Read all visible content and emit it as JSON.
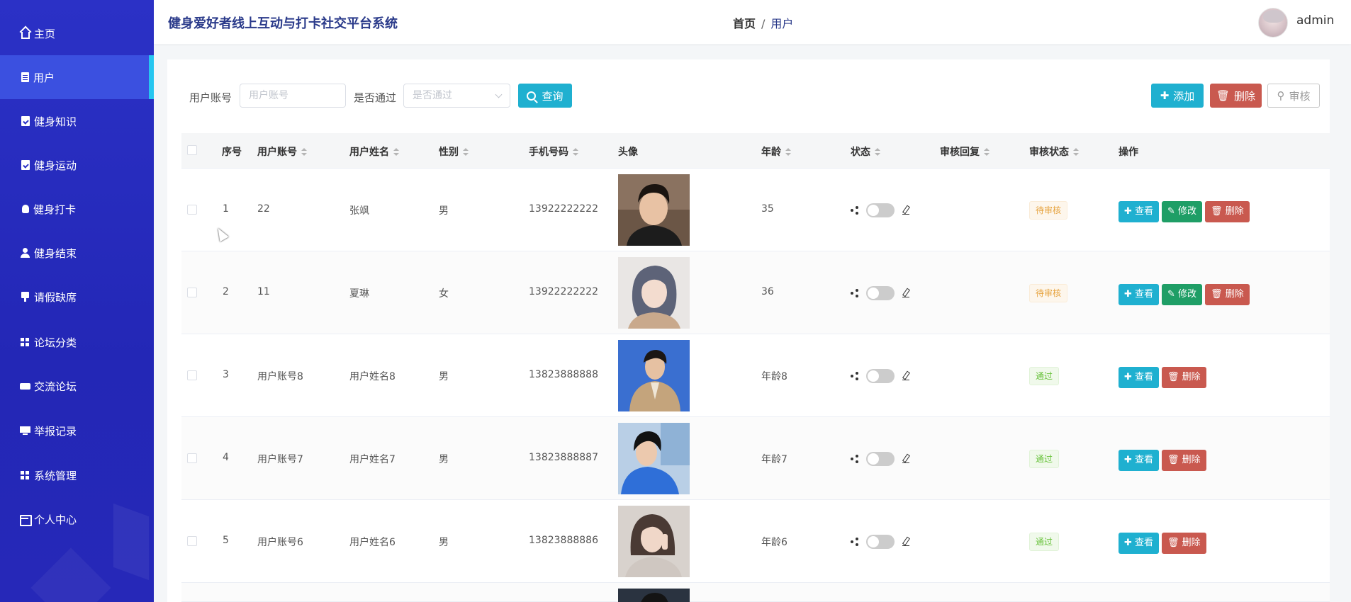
{
  "sidebar": {
    "items": [
      {
        "label": "主页",
        "icon": "home-icon"
      },
      {
        "label": "用户",
        "icon": "document-icon",
        "active": true
      },
      {
        "label": "健身知识",
        "icon": "clipboard-check-icon"
      },
      {
        "label": "健身运动",
        "icon": "clipboard-check-icon"
      },
      {
        "label": "健身打卡",
        "icon": "lightbulb-icon"
      },
      {
        "label": "健身结束",
        "icon": "user-icon"
      },
      {
        "label": "请假缺席",
        "icon": "monitor-icon"
      },
      {
        "label": "论坛分类",
        "icon": "grid-icon"
      },
      {
        "label": "交流论坛",
        "icon": "ticket-icon"
      },
      {
        "label": "举报记录",
        "icon": "screen-icon"
      },
      {
        "label": "系统管理",
        "icon": "grid-icon"
      },
      {
        "label": "个人中心",
        "icon": "id-card-icon"
      }
    ]
  },
  "header": {
    "title": "健身爱好者线上互动与打卡社交平台系统",
    "breadcrumb": [
      "首页",
      "/",
      "用户"
    ],
    "username": "admin"
  },
  "search": {
    "account_label": "用户账号",
    "account_placeholder": "用户账号",
    "approved_label": "是否通过",
    "approved_placeholder": "是否通过",
    "query_button": "查询"
  },
  "toolbar": {
    "add": "添加",
    "delete": "删除",
    "review": "审核"
  },
  "table": {
    "columns": [
      "序号",
      "用户账号",
      "用户姓名",
      "性别",
      "手机号码",
      "头像",
      "年龄",
      "状态",
      "审核回复",
      "审核状态",
      "操作"
    ],
    "rows": [
      {
        "index": "1",
        "account": "22",
        "name": "张飒",
        "gender": "男",
        "phone": "13922222222",
        "age": "35",
        "reply": "",
        "review_status": "待审核",
        "status_type": "pending",
        "photo": "young man, dark shirt"
      },
      {
        "index": "2",
        "account": "11",
        "name": "夏琳",
        "gender": "女",
        "phone": "13922222222",
        "age": "36",
        "reply": "",
        "review_status": "待审核",
        "status_type": "pending",
        "photo": "girl illustration"
      },
      {
        "index": "3",
        "account": "用户账号8",
        "name": "用户姓名8",
        "gender": "男",
        "phone": "13823888888",
        "age": "年龄8",
        "reply": "",
        "review_status": "通过",
        "status_type": "pass",
        "photo": "man in trench coat, blue background"
      },
      {
        "index": "4",
        "account": "用户账号7",
        "name": "用户姓名7",
        "gender": "男",
        "phone": "13823888887",
        "age": "年龄7",
        "reply": "",
        "review_status": "通过",
        "status_type": "pass",
        "photo": "man in blue hoodie outdoors"
      },
      {
        "index": "5",
        "account": "用户账号6",
        "name": "用户姓名6",
        "gender": "男",
        "phone": "13823888886",
        "age": "年龄6",
        "reply": "",
        "review_status": "通过",
        "status_type": "pass",
        "photo": "woman with peace sign"
      }
    ],
    "actions": {
      "view": "查看",
      "edit": "修改",
      "delete": "删除"
    }
  },
  "colors": {
    "sidebar": "#2b31c6",
    "sidebar_active": "#3b50e0",
    "accent_cyan": "#1fb0d0",
    "danger": "#c9594f",
    "success": "#1f9e66"
  }
}
